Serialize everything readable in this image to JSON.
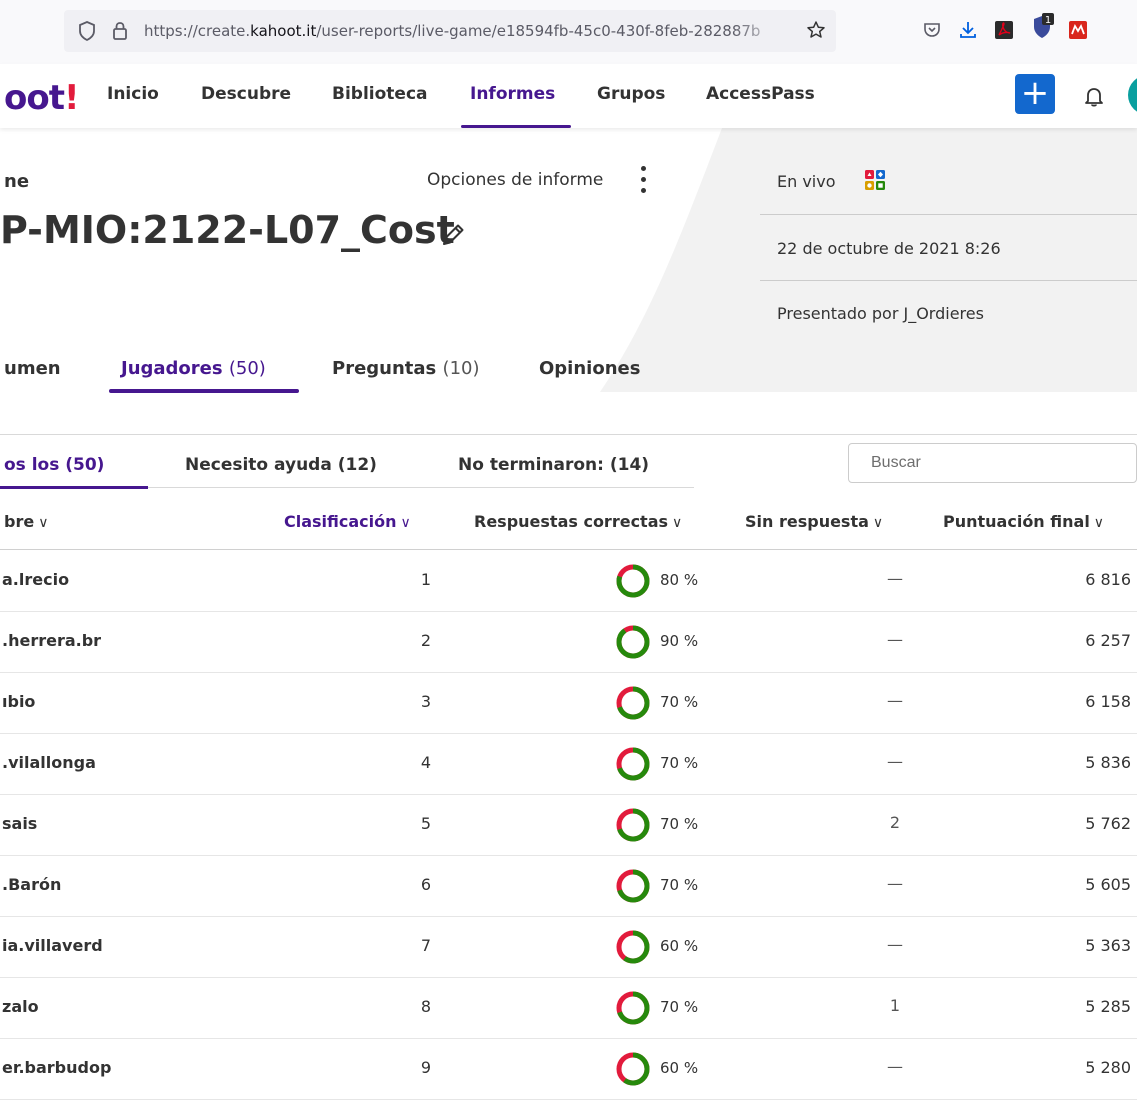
{
  "browser": {
    "url_prefix": "https://create.",
    "url_domain": "kahoot.it",
    "url_path": "/user-reports/live-game/e18594fb-45c0-430f-8feb-282887b"
  },
  "nav": {
    "logo_main": "oot",
    "logo_bang": "!",
    "items": [
      {
        "label": "Inicio"
      },
      {
        "label": "Descubre"
      },
      {
        "label": "Biblioteca"
      },
      {
        "label": "Informes"
      },
      {
        "label": "Grupos"
      },
      {
        "label": "AccessPass"
      }
    ],
    "create_label": "+"
  },
  "report": {
    "label": "ne",
    "title": "P-MIO:2122-L07_Cost",
    "options_label": "Opciones de informe",
    "live_label": "En vivo",
    "date": "22 de octubre de 2021 8:26",
    "host": "Presentado por J_Ordieres"
  },
  "tabs": [
    {
      "label": "umen",
      "count": ""
    },
    {
      "label": "Jugadores",
      "count": "(50)"
    },
    {
      "label": "Preguntas",
      "count": "(10)"
    },
    {
      "label": "Opiniones",
      "count": ""
    }
  ],
  "filters": {
    "all": "os los (50)",
    "need_help": "Necesito ayuda (12)",
    "not_finished": "No terminaron: (14)",
    "search_placeholder": "Buscar"
  },
  "table": {
    "headers": {
      "name": "bre",
      "rank": "Clasificación",
      "correct": "Respuestas correctas",
      "unanswered": "Sin respuesta",
      "score": "Puntuación final"
    },
    "rows": [
      {
        "name": "a.lrecio",
        "rank": "1",
        "correct_pct": "80 %",
        "correct_frac": 0.8,
        "unanswered": "—",
        "score": "6 816"
      },
      {
        "name": ".herrera.br",
        "rank": "2",
        "correct_pct": "90 %",
        "correct_frac": 0.9,
        "unanswered": "—",
        "score": "6 257"
      },
      {
        "name": "ıbio",
        "rank": "3",
        "correct_pct": "70 %",
        "correct_frac": 0.7,
        "unanswered": "—",
        "score": "6 158"
      },
      {
        "name": ".vilallonga",
        "rank": "4",
        "correct_pct": "70 %",
        "correct_frac": 0.7,
        "unanswered": "—",
        "score": "5 836"
      },
      {
        "name": "sais",
        "rank": "5",
        "correct_pct": "70 %",
        "correct_frac": 0.7,
        "unanswered": "2",
        "score": "5 762"
      },
      {
        "name": ".Barón",
        "rank": "6",
        "correct_pct": "70 %",
        "correct_frac": 0.7,
        "unanswered": "—",
        "score": "5 605"
      },
      {
        "name": "ia.villaverd",
        "rank": "7",
        "correct_pct": "60 %",
        "correct_frac": 0.6,
        "unanswered": "—",
        "score": "5 363"
      },
      {
        "name": "zalo",
        "rank": "8",
        "correct_pct": "70 %",
        "correct_frac": 0.7,
        "unanswered": "1",
        "score": "5 285"
      },
      {
        "name": "er.barbudop",
        "rank": "9",
        "correct_pct": "60 %",
        "correct_frac": 0.6,
        "unanswered": "—",
        "score": "5 280"
      }
    ]
  },
  "colors": {
    "brand_purple": "#46178f",
    "kahoot_red": "#e21b3c",
    "button_blue": "#1368ce",
    "donut_correct": "#26890c",
    "donut_incorrect": "#e21b3c"
  }
}
